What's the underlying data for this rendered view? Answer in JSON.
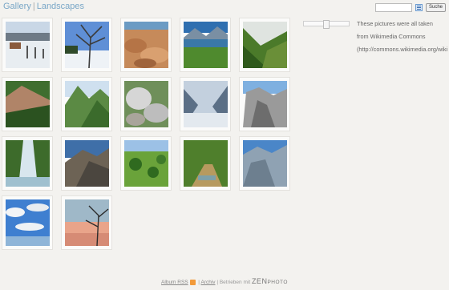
{
  "breadcrumb": {
    "gallery": "Gallery",
    "separator": "|",
    "album": "Landscapes"
  },
  "search": {
    "value": "",
    "button_label": "Suche",
    "options_icon": "search-options-icon"
  },
  "description": {
    "line1": "These pictures were all taken",
    "line2": "from Wikimedia Commons",
    "line3": "(http://commons.wikimedia.org/wiki"
  },
  "thumbnails": [
    {
      "name": "snowy-village"
    },
    {
      "name": "winter-tree"
    },
    {
      "name": "rock-formation"
    },
    {
      "name": "alpine-lake"
    },
    {
      "name": "green-valley"
    },
    {
      "name": "forest-slope"
    },
    {
      "name": "mountain-forest"
    },
    {
      "name": "boulders"
    },
    {
      "name": "misty-valley"
    },
    {
      "name": "cliff-face"
    },
    {
      "name": "waterfall"
    },
    {
      "name": "mountain-ridge"
    },
    {
      "name": "meadow-trees"
    },
    {
      "name": "forest-stream"
    },
    {
      "name": "mountain-cliffs"
    },
    {
      "name": "coast-clouds"
    },
    {
      "name": "sunset-tree"
    }
  ],
  "footer": {
    "rss_label": "Album RSS",
    "sep1": "|",
    "archive_label": "Archiv",
    "sep2": "|",
    "powered_label": "Betrieben mit",
    "brand_zen": "ZEN",
    "brand_photo": "PHOTO"
  },
  "colors": {
    "link": "#7aa7c7",
    "background": "#f3f2ef"
  }
}
